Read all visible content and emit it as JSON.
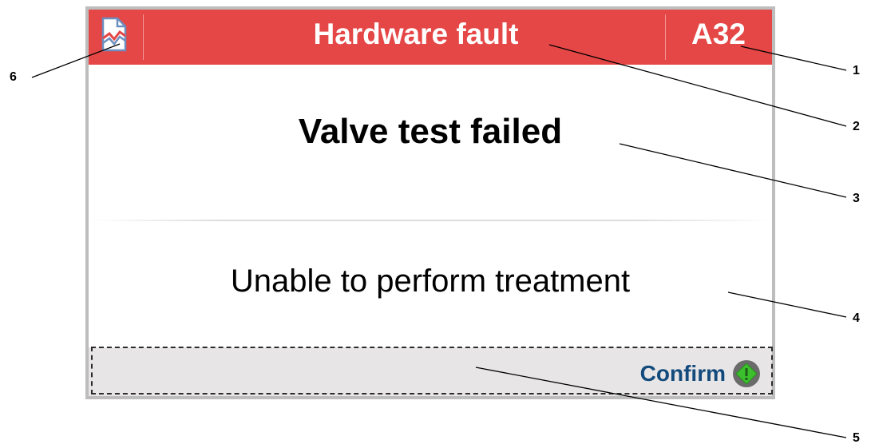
{
  "header": {
    "status_icon": "waveform-document-icon",
    "title": "Hardware fault",
    "code": "A32",
    "color": "#e54646"
  },
  "message": {
    "title": "Valve test failed",
    "detail": "Unable to perform treatment"
  },
  "footer": {
    "confirm_label": "Confirm",
    "confirm_icon": "green-diamond-confirm-icon",
    "label_color": "#134b7d"
  },
  "callouts": [
    "1",
    "2",
    "3",
    "4",
    "5",
    "6"
  ]
}
